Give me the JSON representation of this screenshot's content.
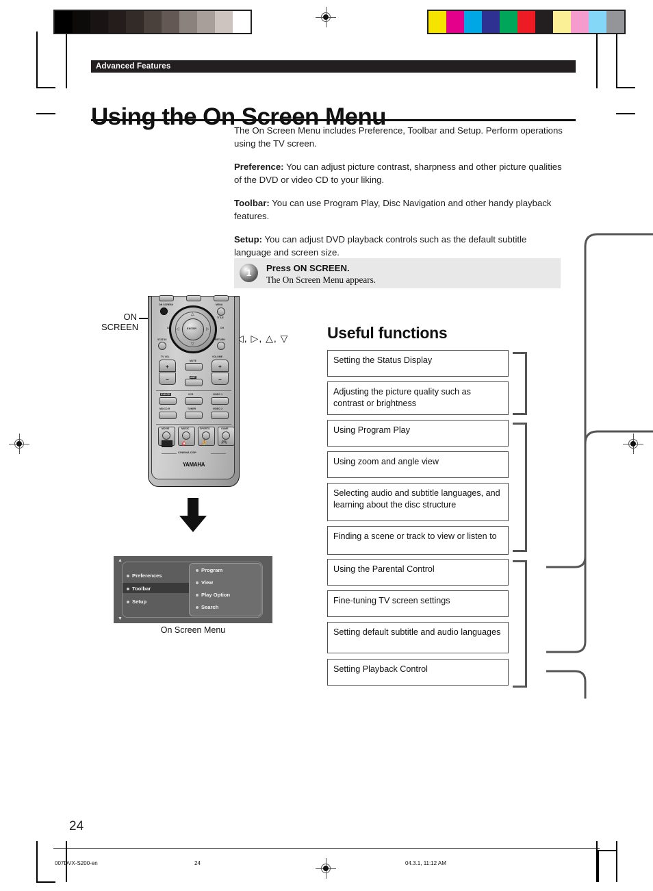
{
  "header": {
    "section_tag": "Advanced Features"
  },
  "title": "Using the On Screen Menu",
  "intro": {
    "p1": "The On Screen Menu includes Preference, Toolbar and Setup. Perform operations using the TV screen.",
    "p2_label": "Preference:",
    "p2_text": " You can adjust picture contrast, sharpness and other picture qualities of the DVD or video CD to your liking.",
    "p3_label": "Toolbar:",
    "p3_text": " You can use Program Play, Disc Navigation and other handy playback features.",
    "p4_label": "Setup:",
    "p4_text": " You can adjust DVD playback controls such as the default subtitle language and screen size."
  },
  "step": {
    "number": "1",
    "heading": "Press ON SCREEN.",
    "detail": "The On Screen Menu appears."
  },
  "callouts": {
    "on_screen_line1": "ON",
    "on_screen_line2": "SCREEN",
    "cursor_keys": "◁, ▷, △, ▽"
  },
  "remote": {
    "brand": "YAMAHA",
    "cinema_dsp": "CINEMA DSP",
    "labels": {
      "on_screen": "ON SCREEN",
      "menu": "MENU",
      "enter": "ENTER",
      "title": "TITLE",
      "status": "STATUS",
      "return": "RETURN",
      "ch_down": "CH",
      "ch_up": "CH",
      "tv_vol": "TV VOL",
      "mute": "MUTE",
      "volume": "VOLUME",
      "amp": "AMP",
      "plus": "+",
      "minus": "−"
    },
    "source_buttons": [
      "DVD/CD",
      "VCR",
      "VIDEO 1",
      "MD/CD-R",
      "TUNER",
      "VIDEO 2"
    ],
    "mode_buttons": [
      "MOVIE",
      "MUSIC",
      "SPORTS",
      "GAME"
    ]
  },
  "osd": {
    "caption": "On Screen Menu",
    "left_items": [
      "Preferences",
      "Toolbar",
      "Setup"
    ],
    "selected_left": "Toolbar",
    "right_items": [
      "Program",
      "View",
      "Play Option",
      "Search"
    ],
    "scroll_up": "▲",
    "scroll_down": "▼"
  },
  "useful_functions": {
    "title": "Useful functions",
    "items": [
      "Setting the Status Display",
      "Adjusting the picture quality such as contrast or brightness",
      "Using Program Play",
      "Using zoom and angle view",
      "Selecting audio and subtitle languages, and learning about the disc structure",
      "Finding a scene or track to view or listen to",
      "Using the Parental Control",
      "Fine-tuning TV screen settings",
      "Setting default subtitle and audio languages",
      "Setting Playback Control"
    ]
  },
  "page": {
    "number": "24"
  },
  "footer": {
    "file": "007DVX-S200-en",
    "page": "24",
    "timestamp": "04.3.1, 11:12 AM"
  },
  "print_marks": {
    "gray_swatches": [
      "#000000",
      "#0d0a0a",
      "#191313",
      "#241d1b",
      "#332b28",
      "#4a403c",
      "#635854",
      "#8b817d",
      "#a89e9a",
      "#cdc4c0",
      "#ffffff"
    ],
    "color_swatches": [
      "#f5e400",
      "#e5008c",
      "#00a7e5",
      "#2e3192",
      "#00a65a",
      "#ed1c24",
      "#231f20",
      "#fbf096",
      "#f59bce",
      "#85d7f7",
      "#939598"
    ]
  }
}
